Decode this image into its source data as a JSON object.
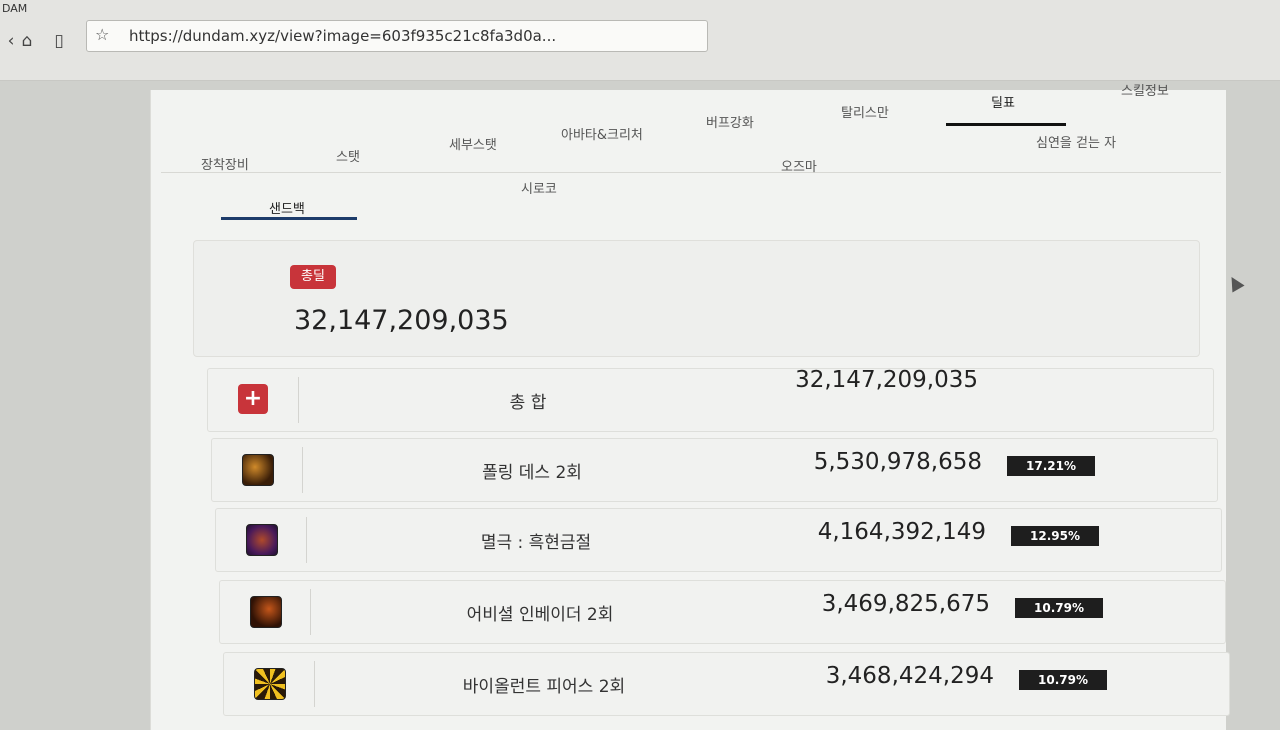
{
  "browser": {
    "app_corner_text": "DAM",
    "url": "https://dundam.xyz/view?image=603f935c21c8fa3d0a...",
    "icons": [
      "back-icon",
      "home-icon",
      "reader-icon",
      "star-icon"
    ]
  },
  "tabs": {
    "row1": [
      "스킬정보",
      "딜표",
      "탈리스만",
      "버프강화",
      "아바타&크리처",
      "세부스탯",
      "스탯",
      "장착장비"
    ],
    "active": "딜표"
  },
  "subtabs": {
    "sandbag": "샌드백",
    "siroco": "시로코",
    "ozma": "오즈마",
    "abyss": "심연을 걷는 자",
    "active": "샌드백"
  },
  "total": {
    "badge": "총딜",
    "value": "32,147,209,035"
  },
  "rows": [
    {
      "name": "총 합",
      "damage": "32,147,209,035",
      "percent": "",
      "icon": "plus-icon"
    },
    {
      "name": "폴링 데스 2회",
      "damage": "5,530,978,658",
      "percent": "17.21%",
      "icon": "falling-death-skill-icon"
    },
    {
      "name": "멸극 : 흑현금절",
      "damage": "4,164,392,149",
      "percent": "12.95%",
      "icon": "myeolgeuk-skill-icon"
    },
    {
      "name": "어비셜 인베이더 2회",
      "damage": "3,469,825,675",
      "percent": "10.79%",
      "icon": "abyssal-invader-skill-icon"
    },
    {
      "name": "바이올런트 피어스 2회",
      "damage": "3,468,424,294",
      "percent": "10.79%",
      "icon": "violent-pierce-skill-icon"
    }
  ],
  "colors": {
    "badge_red": "#c8343a",
    "percent_bar": "#1e1e1e",
    "active_underline": "#1d3b6a"
  }
}
